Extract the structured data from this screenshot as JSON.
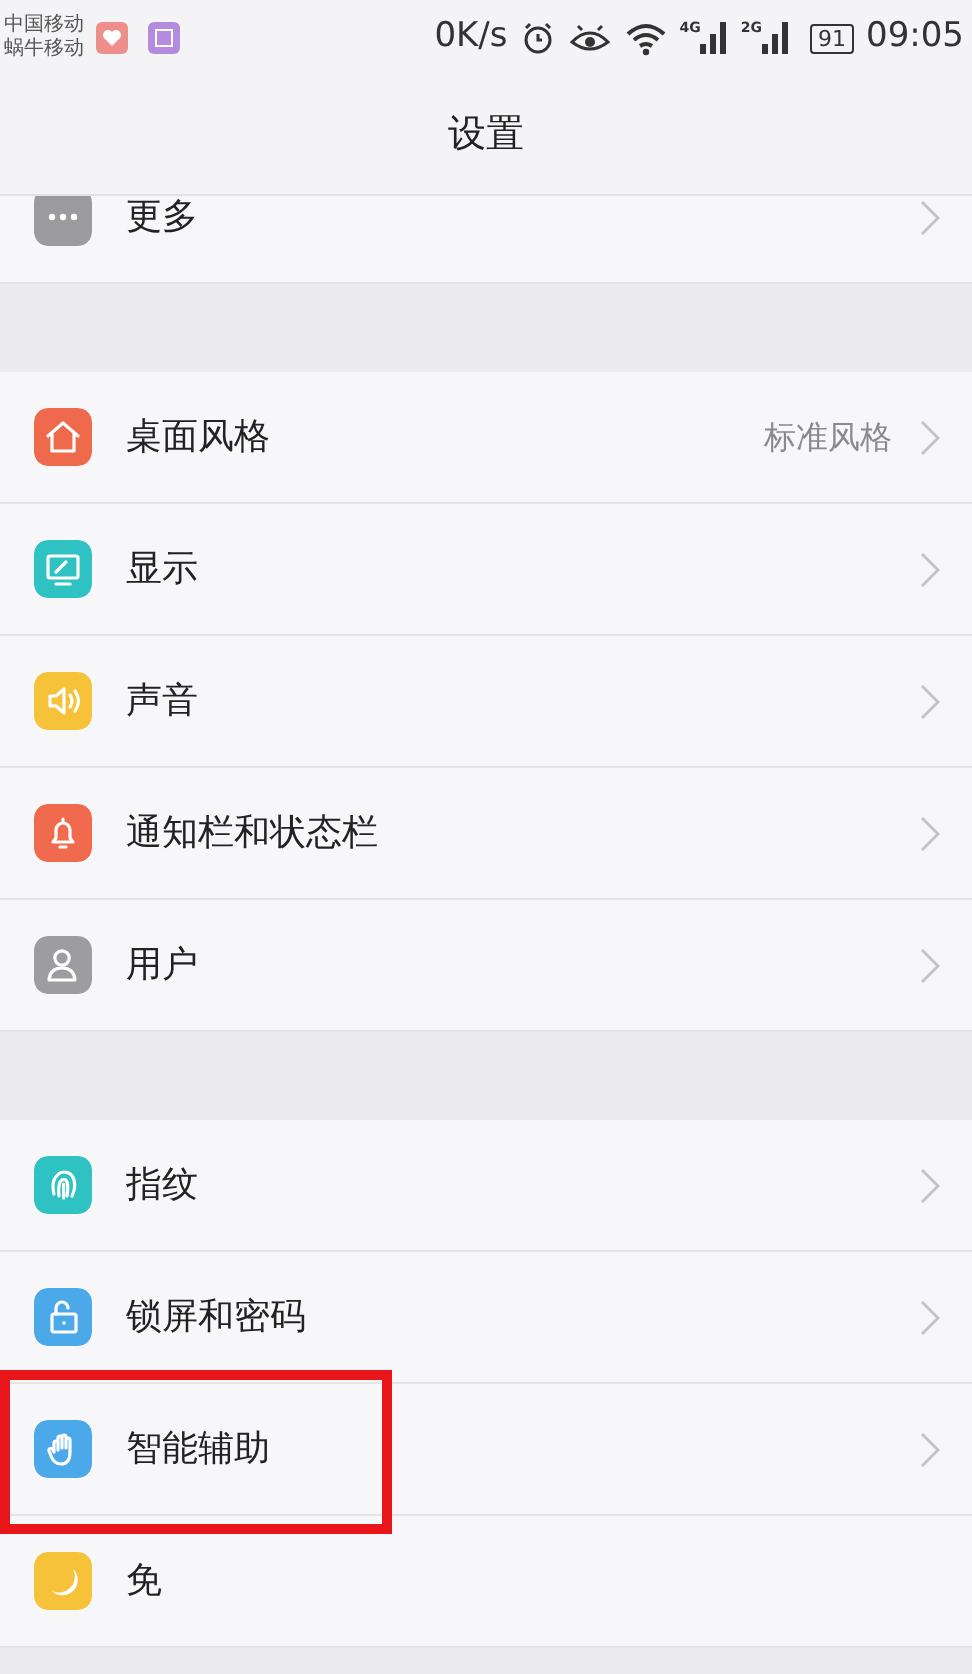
{
  "status_bar": {
    "carriers": [
      "中国移动",
      "蜗牛移动"
    ],
    "speed": "0K/s",
    "network_1": "4G",
    "network_2": "2G",
    "battery": "91",
    "time": "09:05"
  },
  "header": {
    "title": "设置"
  },
  "groups": [
    {
      "cut_top": true,
      "items": [
        {
          "label": "更多",
          "color": "#9b9b9d",
          "highlighted": false
        }
      ]
    },
    {
      "items": [
        {
          "label": "桌面风格",
          "value": "标准风格",
          "color": "#ef6a4c",
          "highlighted": false
        },
        {
          "label": "显示",
          "color": "#2fc2c3",
          "highlighted": false
        },
        {
          "label": "声音",
          "color": "#f5c23a",
          "highlighted": false
        },
        {
          "label": "通知栏和状态栏",
          "color": "#f06a4d",
          "highlighted": false
        },
        {
          "label": "用户",
          "color": "#9d9d9f",
          "highlighted": false
        }
      ]
    },
    {
      "items": [
        {
          "label": "指纹",
          "color": "#2fc2c3",
          "highlighted": false
        },
        {
          "label": "锁屏和密码",
          "color": "#4ba9e9",
          "highlighted": false
        },
        {
          "label": "智能辅助",
          "color": "#4ba9e9",
          "highlighted": true
        },
        {
          "label": "免",
          "color": "#f5c23a",
          "highlighted": false,
          "chevron": false
        }
      ]
    }
  ]
}
